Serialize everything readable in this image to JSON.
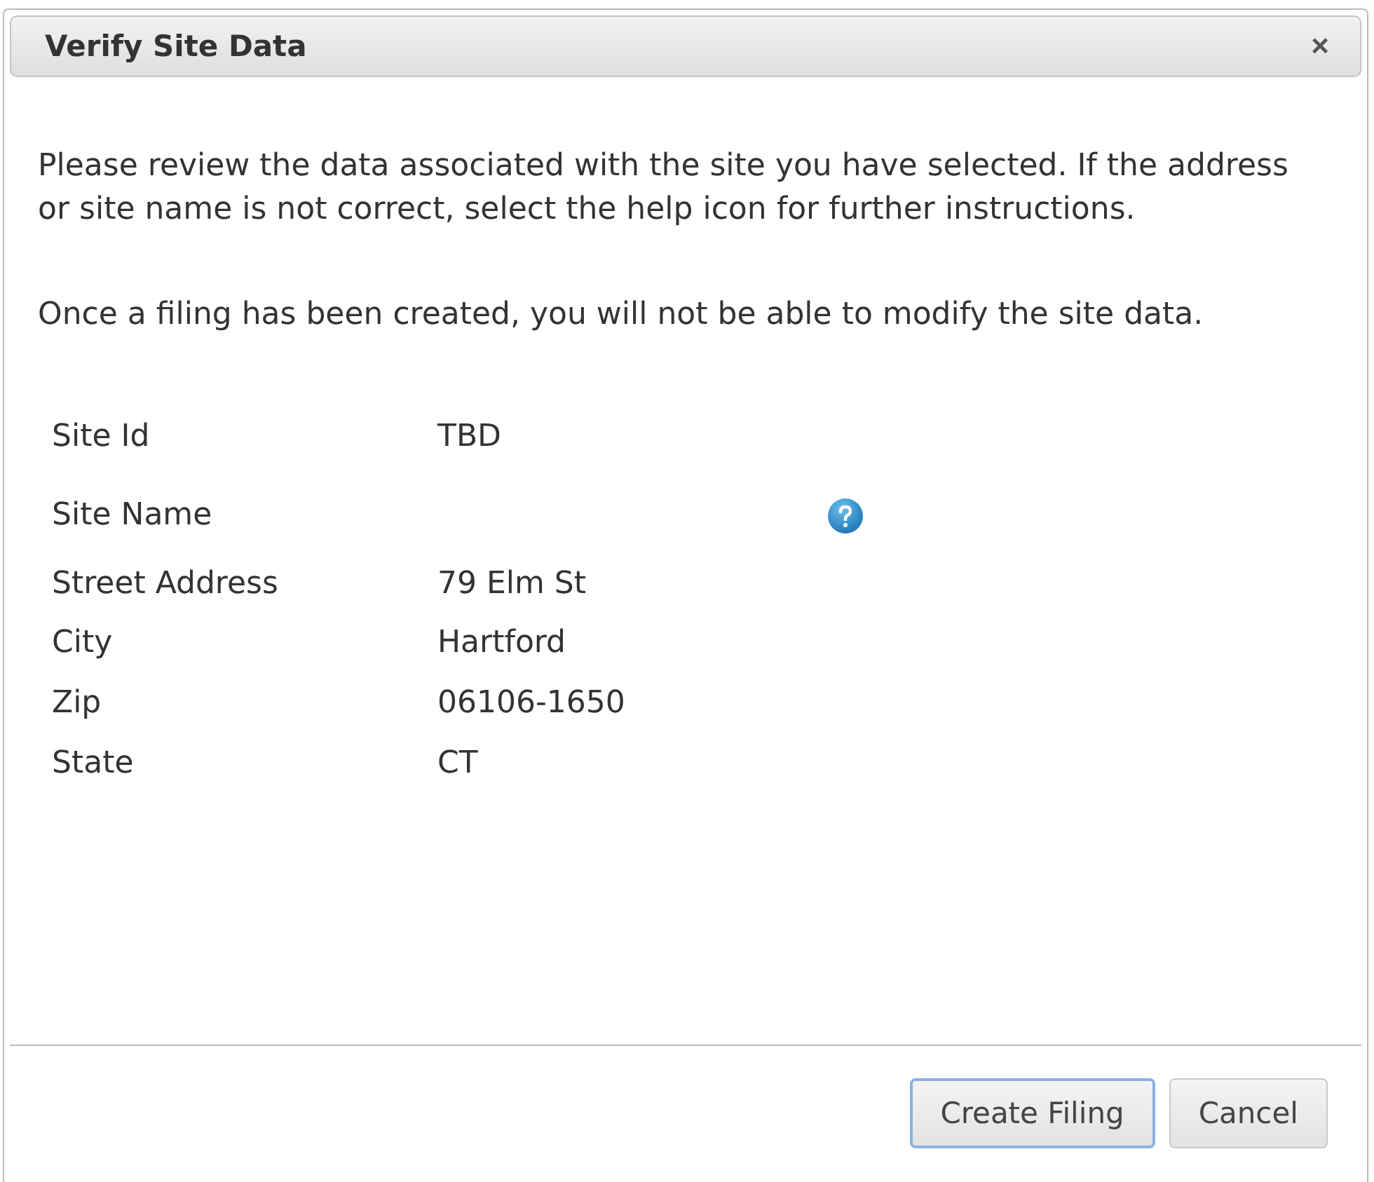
{
  "dialog": {
    "title": "Verify Site Data",
    "close": "×"
  },
  "paragraphs": [
    "Please review the data associated with the site you have selected. If the address or site name is not correct, select the help icon for further instructions.",
    "Once a filing has been created, you will not be able to modify the site data."
  ],
  "fields": [
    {
      "label": "Site Id",
      "value": "TBD",
      "help": false
    },
    {
      "label": "Site Name",
      "help": true
    },
    {
      "label": "Street Address",
      "value": "79 Elm St",
      "help": false
    },
    {
      "label": "City",
      "value": "Hartford",
      "help": false
    },
    {
      "label": "Zip",
      "value": "06106-1650",
      "help": false
    },
    {
      "label": "State",
      "value": "CT",
      "help": false
    }
  ],
  "buttons": [
    {
      "label": "Create Filing",
      "focused": true
    },
    {
      "label": "Cancel",
      "focused": false
    }
  ]
}
